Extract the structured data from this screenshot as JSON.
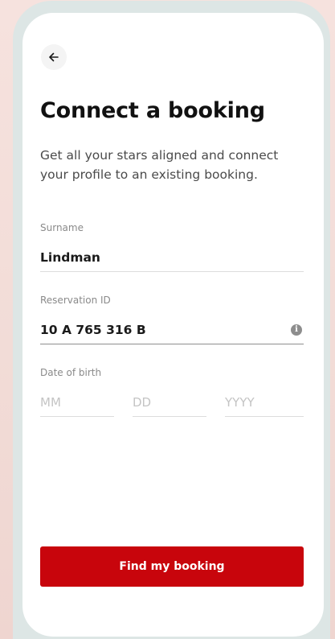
{
  "header": {
    "back_icon": "arrow-left-icon"
  },
  "page": {
    "title": "Connect a booking",
    "subtitle": "Get all your stars aligned and connect your profile to an existing booking."
  },
  "form": {
    "surname": {
      "label": "Surname",
      "value": "Lindman"
    },
    "reservation": {
      "label": "Reservation ID",
      "value": "10 A 765 316 B",
      "info_icon": "info-icon"
    },
    "dob": {
      "label": "Date of birth",
      "month_placeholder": "MM",
      "day_placeholder": "DD",
      "year_placeholder": "YYYY"
    }
  },
  "actions": {
    "submit_label": "Find my booking"
  },
  "colors": {
    "brand_red": "#c8050c",
    "frame": "#dde6e5",
    "background": "#f6e2de"
  }
}
